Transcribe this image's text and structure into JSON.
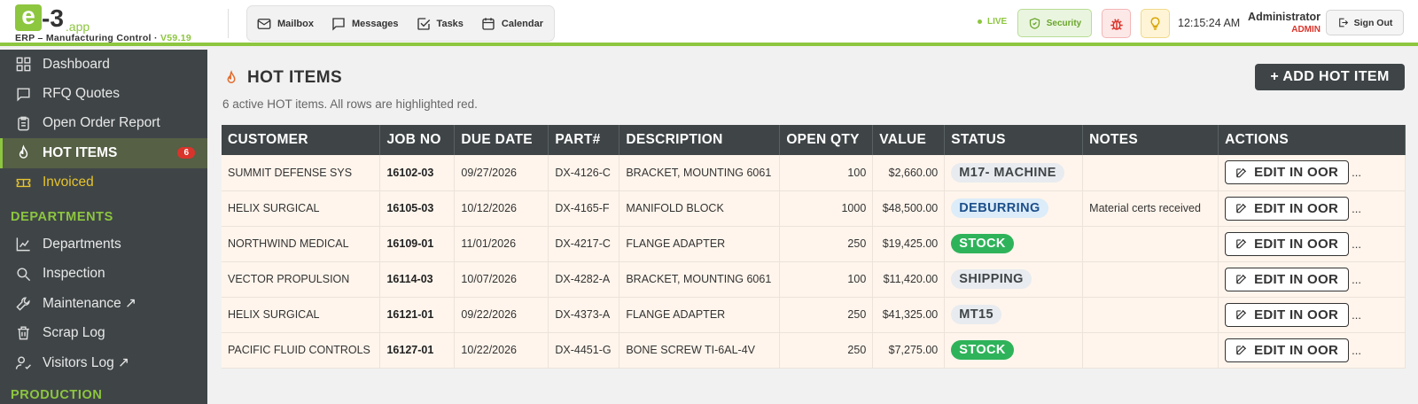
{
  "header": {
    "logo_e": "e",
    "logo_3": "-3",
    "logo_app": ".app",
    "subtitle": "ERP – Manufacturing Control ·",
    "version": "V59.19",
    "nav": [
      {
        "label": "Mailbox",
        "icon": "mail-icon"
      },
      {
        "label": "Messages",
        "icon": "message-icon"
      },
      {
        "label": "Tasks",
        "icon": "checkbox-icon"
      },
      {
        "label": "Calendar",
        "icon": "calendar-icon"
      }
    ],
    "live": "LIVE",
    "security": "Security",
    "clock": "12:15:24 AM",
    "user_name": "Administrator",
    "user_role": "ADMIN",
    "signout": "Sign Out"
  },
  "sidebar": {
    "items": [
      {
        "label": "Dashboard",
        "icon": "grid-icon"
      },
      {
        "label": "RFQ Quotes",
        "icon": "quote-icon"
      },
      {
        "label": "Open Order Report",
        "icon": "clipboard-icon"
      },
      {
        "label": "HOT ITEMS",
        "icon": "flame-icon",
        "badge": "6"
      },
      {
        "label": "Invoiced",
        "icon": "ticket-icon"
      }
    ],
    "section_departments": "DEPARTMENTS",
    "dept_items": [
      {
        "label": "Departments",
        "icon": "chart-icon"
      },
      {
        "label": "Inspection",
        "icon": "search-icon"
      },
      {
        "label": "Maintenance ↗",
        "icon": "wrench-icon"
      },
      {
        "label": "Scrap Log",
        "icon": "trash-icon"
      },
      {
        "label": "Visitors Log ↗",
        "icon": "user-check-icon"
      }
    ],
    "section_production": "PRODUCTION"
  },
  "main": {
    "title": "HOT ITEMS",
    "add_button": "+ ADD HOT ITEM",
    "info": "6 active HOT items. All rows are highlighted red.",
    "columns": [
      "CUSTOMER",
      "JOB NO",
      "DUE DATE",
      "PART#",
      "DESCRIPTION",
      "OPEN QTY",
      "VALUE",
      "STATUS",
      "NOTES",
      "ACTIONS"
    ],
    "rows": [
      {
        "customer": "SUMMIT DEFENSE SYS",
        "job": "16102-03",
        "due": "09/27/2026",
        "part": "DX-4126-C",
        "desc": "BRACKET, MOUNTING 6061",
        "qty": "100",
        "value": "$2,660.00",
        "status": "M17- MACHINE",
        "status_style": "gray",
        "notes": "",
        "action": "EDIT IN OOR",
        "more": "..."
      },
      {
        "customer": "HELIX SURGICAL",
        "job": "16105-03",
        "due": "10/12/2026",
        "part": "DX-4165-F",
        "desc": "MANIFOLD BLOCK",
        "qty": "1000",
        "value": "$48,500.00",
        "status": "DEBURRING",
        "status_style": "blue",
        "notes": "Material certs received",
        "action": "EDIT IN OOR",
        "more": "..."
      },
      {
        "customer": "NORTHWIND MEDICAL",
        "job": "16109-01",
        "due": "11/01/2026",
        "part": "DX-4217-C",
        "desc": "FLANGE ADAPTER",
        "qty": "250",
        "value": "$19,425.00",
        "status": "STOCK",
        "status_style": "green",
        "notes": "",
        "action": "EDIT IN OOR",
        "more": "..."
      },
      {
        "customer": "VECTOR PROPULSION",
        "job": "16114-03",
        "due": "10/07/2026",
        "part": "DX-4282-A",
        "desc": "BRACKET, MOUNTING 6061",
        "qty": "100",
        "value": "$11,420.00",
        "status": "SHIPPING",
        "status_style": "gray",
        "notes": "",
        "action": "EDIT IN OOR",
        "more": "..."
      },
      {
        "customer": "HELIX SURGICAL",
        "job": "16121-01",
        "due": "09/22/2026",
        "part": "DX-4373-A",
        "desc": "FLANGE ADAPTER",
        "qty": "250",
        "value": "$41,325.00",
        "status": "MT15",
        "status_style": "gray",
        "notes": "",
        "action": "EDIT IN OOR",
        "more": "..."
      },
      {
        "customer": "PACIFIC FLUID CONTROLS",
        "job": "16127-01",
        "due": "10/22/2026",
        "part": "DX-4451-G",
        "desc": "BONE SCREW TI-6AL-4V",
        "qty": "250",
        "value": "$7,275.00",
        "status": "STOCK",
        "status_style": "green",
        "notes": "",
        "action": "EDIT IN OOR",
        "more": "..."
      }
    ]
  },
  "colors": {
    "brand": "#8dc63f",
    "sidebar": "#3f4547",
    "hot_row": "#fff5ec",
    "danger": "#d9342b"
  }
}
